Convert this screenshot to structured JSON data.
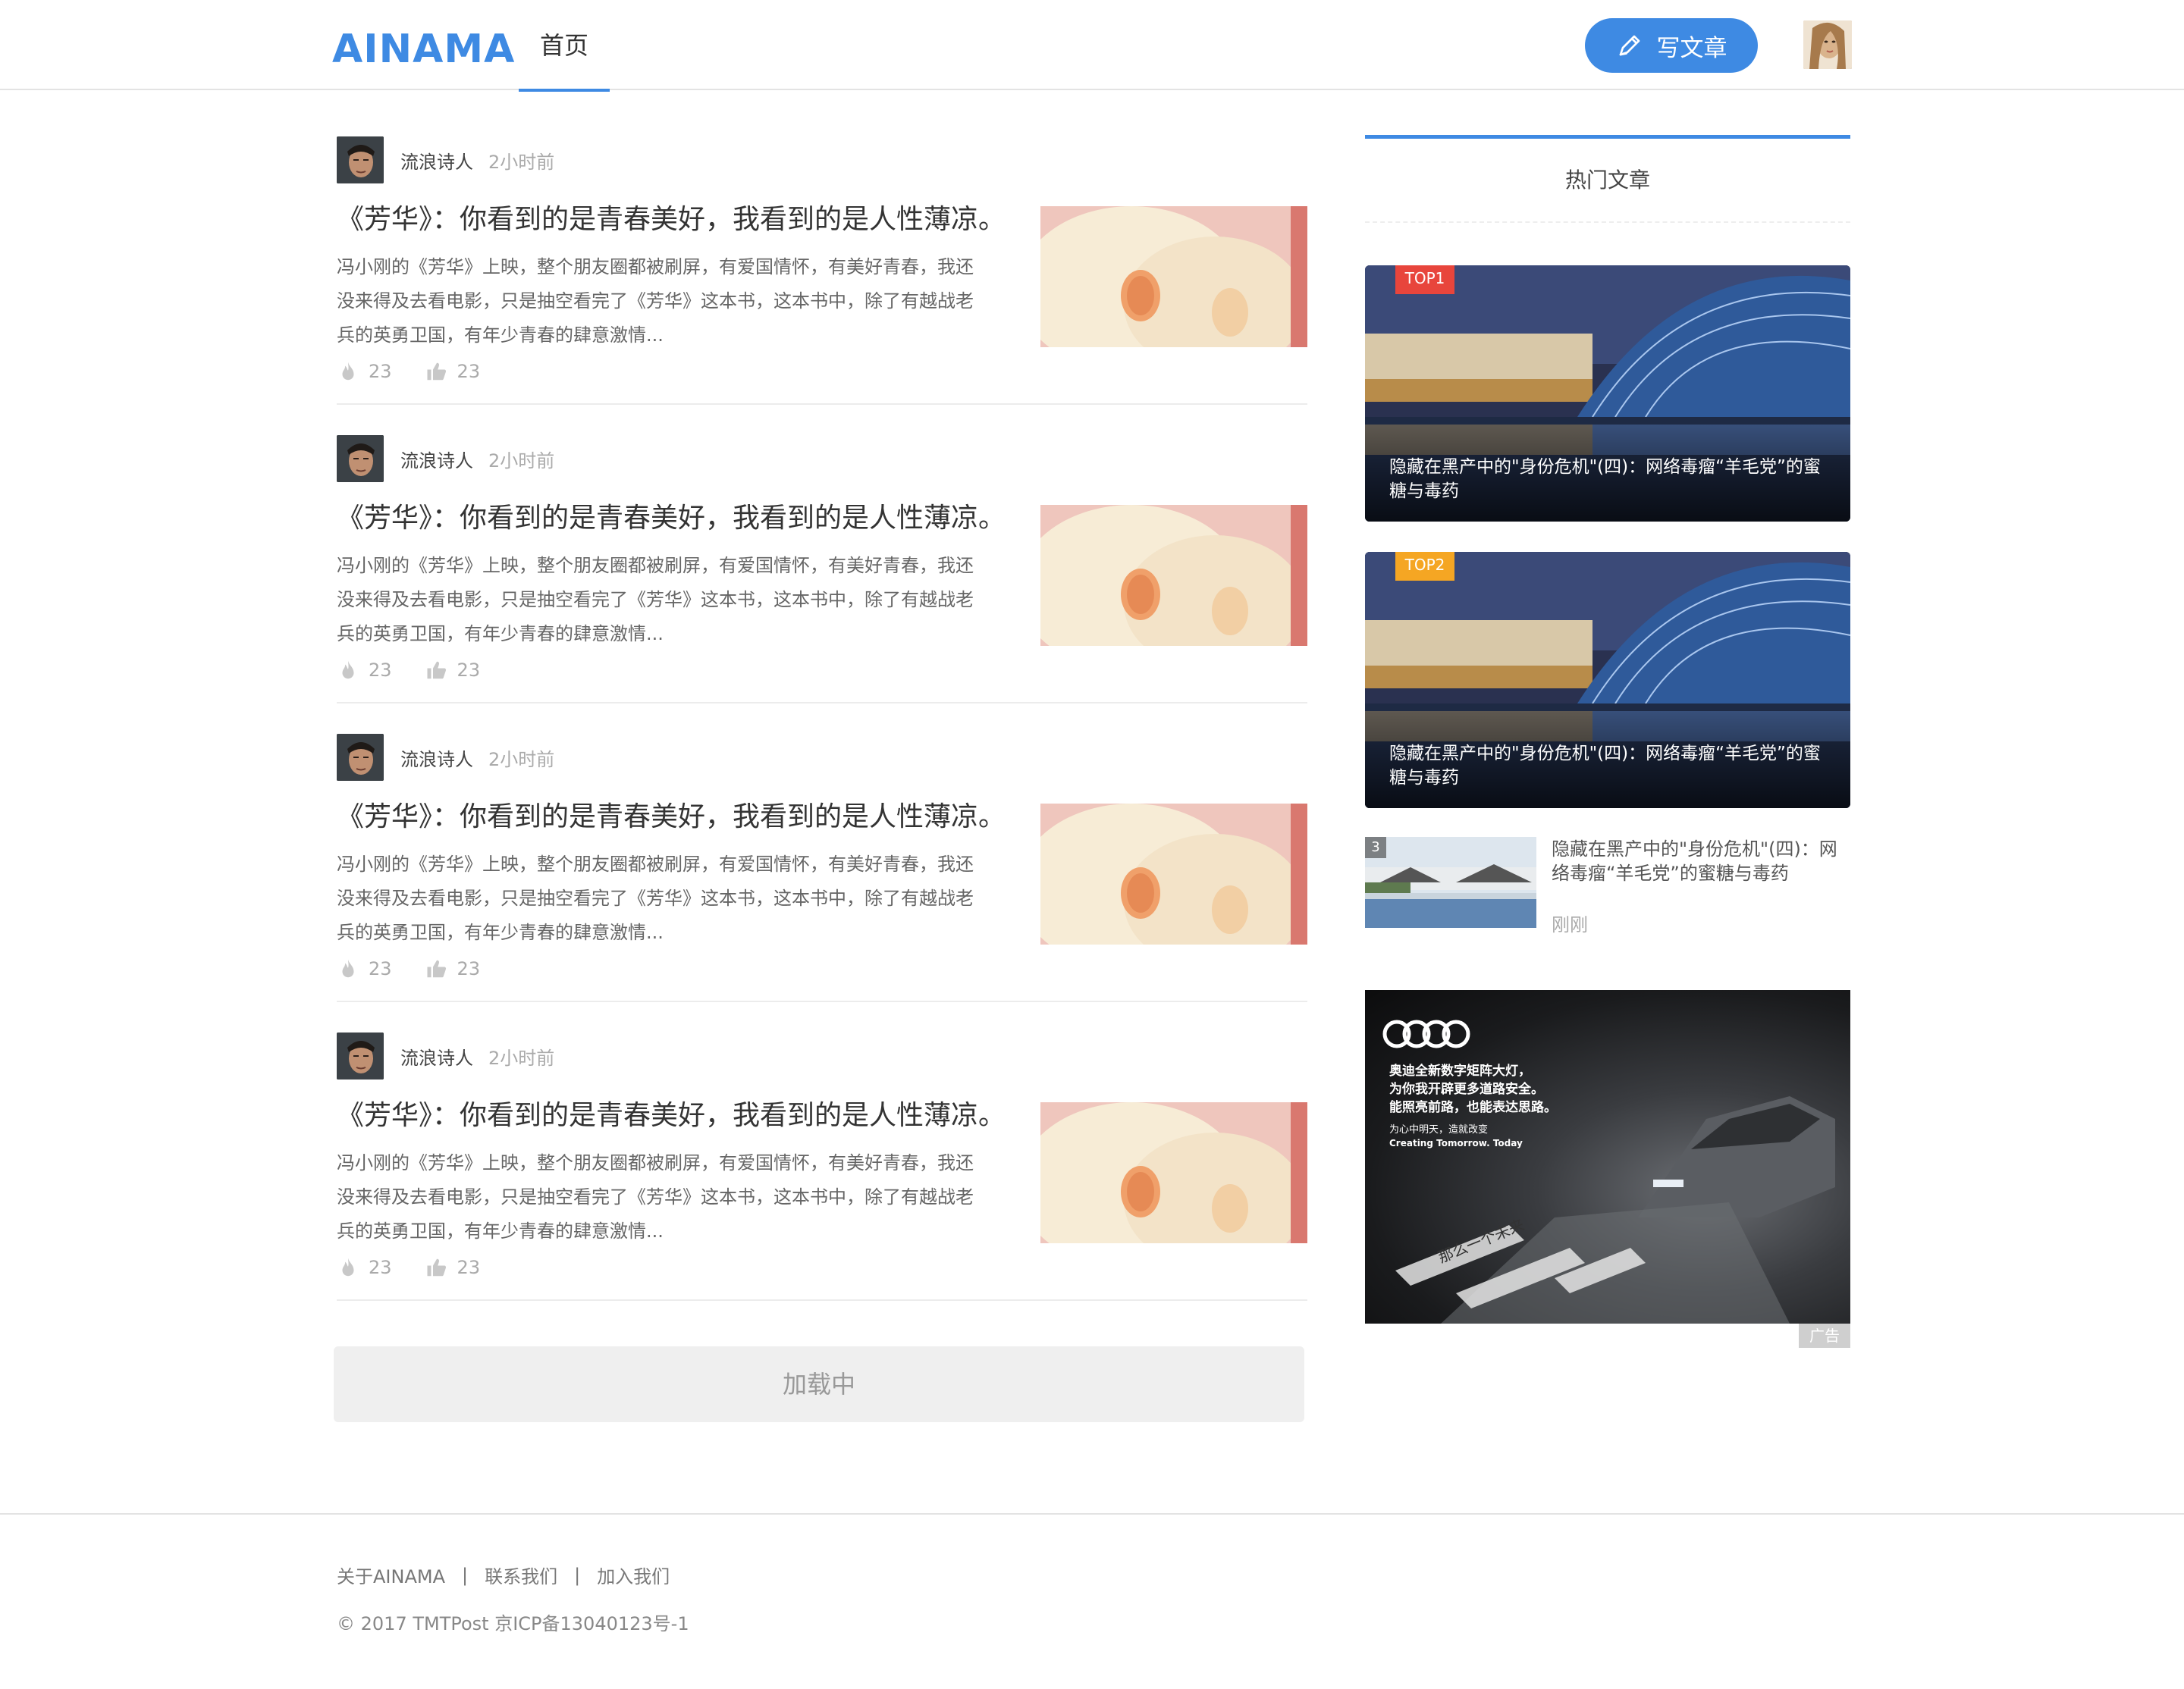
{
  "header": {
    "logo": "AINAMA",
    "nav_home": "首页",
    "write_button": "写文章",
    "accent_color": "#3e8ae3"
  },
  "articles": [
    {
      "author": "流浪诗人",
      "time": "2小时前",
      "title": "《芳华》：你看到的是青春美好，我看到的是人性薄凉。",
      "excerpt": "冯小刚的《芳华》上映，整个朋友圈都被刷屏，有爱国情怀，有美好青春，我还没来得及去看电影，只是抽空看完了《芳华》这本书，这本书中，除了有越战老兵的英勇卫国，有年少青春的肆意激情...",
      "views": "23",
      "likes": "23"
    },
    {
      "author": "流浪诗人",
      "time": "2小时前",
      "title": "《芳华》：你看到的是青春美好，我看到的是人性薄凉。",
      "excerpt": "冯小刚的《芳华》上映，整个朋友圈都被刷屏，有爱国情怀，有美好青春，我还没来得及去看电影，只是抽空看完了《芳华》这本书，这本书中，除了有越战老兵的英勇卫国，有年少青春的肆意激情...",
      "views": "23",
      "likes": "23"
    },
    {
      "author": "流浪诗人",
      "time": "2小时前",
      "title": "《芳华》：你看到的是青春美好，我看到的是人性薄凉。",
      "excerpt": "冯小刚的《芳华》上映，整个朋友圈都被刷屏，有爱国情怀，有美好青春，我还没来得及去看电影，只是抽空看完了《芳华》这本书，这本书中，除了有越战老兵的英勇卫国，有年少青春的肆意激情...",
      "views": "23",
      "likes": "23"
    },
    {
      "author": "流浪诗人",
      "time": "2小时前",
      "title": "《芳华》：你看到的是青春美好，我看到的是人性薄凉。",
      "excerpt": "冯小刚的《芳华》上映，整个朋友圈都被刷屏，有爱国情怀，有美好青春，我还没来得及去看电影，只是抽空看完了《芳华》这本书，这本书中，除了有越战老兵的英勇卫国，有年少青春的肆意激情...",
      "views": "23",
      "likes": "23"
    }
  ],
  "loading_text": "加载中",
  "sidebar": {
    "hot_title": "热门文章",
    "top_cards": [
      {
        "badge": "TOP1",
        "badge_color": "#e8453c",
        "caption": "隐藏在黑产中的\"身份危机\"(四)：网络毒瘤“羊毛党”的蜜糖与毒药"
      },
      {
        "badge": "TOP2",
        "badge_color": "#f5a623",
        "caption": "隐藏在黑产中的\"身份危机\"(四)：网络毒瘤“羊毛党”的蜜糖与毒药"
      }
    ],
    "small_item": {
      "rank": "3",
      "title": "隐藏在黑产中的\"身份危机\"(四)：网络毒瘤“羊毛党”的蜜糖与毒药",
      "time": "刚刚"
    },
    "ad": {
      "headline1": "奥迪全新数字矩阵大灯，",
      "headline2": "为你我开辟更多道路安全。",
      "headline3": "能照亮前路，也能表达思路。",
      "slogan_cn": "为心中明天，造就改变",
      "slogan_en": "Creating Tomorrow. Today",
      "road_text": "那么一个未来",
      "label": "广告"
    }
  },
  "footer": {
    "links": [
      "关于AINAMA",
      "联系我们",
      "加入我们"
    ],
    "separator": "|",
    "copyright": "© 2017 TMTPost 京ICP备13040123号-1"
  }
}
